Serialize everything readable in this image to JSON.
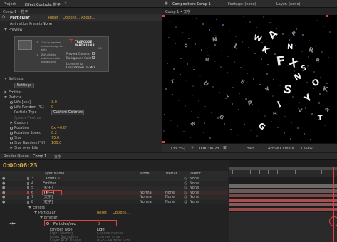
{
  "app": {
    "accent": "#d9a640",
    "highlight": "#e04040"
  },
  "left_panel": {
    "top_tabs": [
      "Project",
      "Effect Controls: 粒子"
    ],
    "breadcrumb": "Comp 1 • 粒子",
    "effect_name": "Particular",
    "reset": "Reset",
    "options": "Options...",
    "about": "About...",
    "animation_presets_label": "Animation Presets:",
    "animation_presets_value": "None",
    "preview_label": "Preview",
    "preview_hint1": "Click to preview and see image to write",
    "preview_hint2": "Shift-click to position emitter interactively",
    "brand_line1": "TRAPCODE",
    "brand_line2": "PARTICULAR",
    "brand_version": "2.0",
    "preview_camera": "Preview Camera",
    "background_color": "Background Color",
    "licensed_to": "Licensed to:",
    "licensed_name": "Unlicensed DEMO",
    "settings_label": "Settings",
    "settings_btn": "Settings",
    "emitter": "Emitter",
    "particle": "Particle",
    "life_sec_label": "Life [sec]",
    "life_sec_value": "3.0",
    "life_random_label": "Life Random [%]",
    "life_random_value": "0",
    "particle_type_label": "Particle Type",
    "particle_type_value": "Custom Colorize",
    "sphere_feather": "Sphere Feather",
    "custom": "Custom",
    "rotation_label": "Rotation",
    "rotation_value": "0x +0.0°",
    "rotation_speed_label": "Rotation Speed",
    "rotation_speed_value": "0.2",
    "size_label": "Size",
    "size_value": "75.0",
    "size_random_label": "Size Random [%]",
    "size_random_value": "100.0",
    "size_over_life": "Size over Life"
  },
  "viewer": {
    "tabs": [
      "Composition: Comp 1",
      "Footage: (none)",
      "Layer: (none)"
    ],
    "breadcrumb": "Comp 1 • 文字",
    "letters": [
      "A",
      "F",
      "X",
      "N",
      "S",
      "Y",
      "T",
      "K",
      "S",
      "W",
      "O",
      "N",
      "G",
      "P",
      "L",
      "J",
      "V",
      "U",
      "N",
      "G",
      "W",
      "K",
      "Y",
      "H",
      "E",
      "L",
      "R",
      "P",
      "M",
      "O",
      "T",
      "R",
      "A"
    ],
    "zoom": "(33.3%)",
    "timecode": "0:00:06:23",
    "resolution": "Half",
    "camera": "Active Camera",
    "view": "1 View"
  },
  "timeline": {
    "tabs": [
      "Render Queue",
      "Comp 1",
      "文字"
    ],
    "timecode": "0:00:06:23",
    "col_layer_name": "Layer Name",
    "col_mode": "Mode",
    "col_trkmat": "TrkMat",
    "col_parent": "Parent",
    "layers": [
      {
        "num": "3",
        "name": "Camera 1",
        "mode": "",
        "trkmat": "",
        "parent": "None"
      },
      {
        "num": "4",
        "name": "Emitter",
        "mode": "",
        "trkmat": "",
        "parent": "None"
      },
      {
        "num": "5",
        "name": "[粒子]",
        "mode": "",
        "trkmat": "",
        "parent": "None"
      },
      {
        "num": "6",
        "name": "[粒子]",
        "mode": "Normal",
        "trkmat": "None",
        "parent": "None"
      },
      {
        "num": "7",
        "name": "[文字]",
        "mode": "Normal",
        "trkmat": "None",
        "parent": "None"
      },
      {
        "num": "8",
        "name": "[粒子]",
        "mode": "Normal",
        "trkmat": "None",
        "parent": "None"
      }
    ],
    "effects": "Effects",
    "particular": "Particular",
    "reset": "Reset",
    "options": "Options...",
    "emitter": "Emitter",
    "particles_sec_label": "Particles/sec",
    "particles_sec_value": "0",
    "emitter_type_label": "Emitter Type",
    "emitter_type_value": "Light",
    "sub_props": [
      "Light Naming",
      "Layer Sampling",
      "Layer RGB Usage",
      "Direction"
    ],
    "sub_values": [
      "Choose Names",
      "Current Time",
      "RGB - Particle Size",
      "Uniform"
    ]
  }
}
